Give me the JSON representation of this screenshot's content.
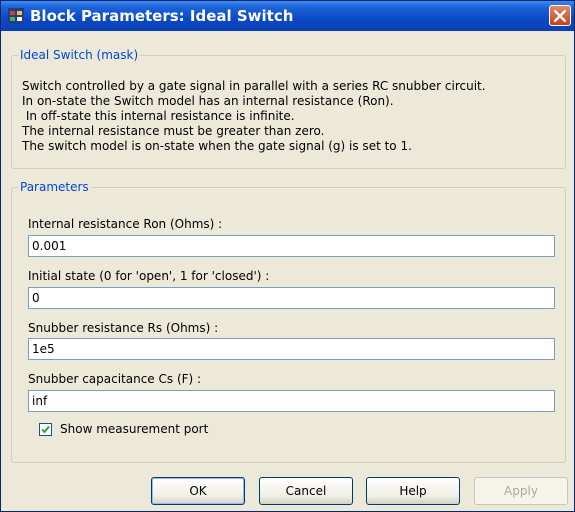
{
  "window": {
    "title": "Block Parameters: Ideal Switch"
  },
  "mask_group": {
    "legend": "Ideal Switch (mask)",
    "description": [
      "Switch controlled by a gate signal in parallel with a series RC snubber circuit.",
      "In on-state the Switch model has an internal resistance (Ron).",
      " In off-state this internal resistance is infinite.",
      "The internal resistance must be greater than zero.",
      "The switch model is on-state when the gate signal (g) is set to 1."
    ]
  },
  "params_group": {
    "legend": "Parameters",
    "fields": [
      {
        "label": "Internal resistance Ron (Ohms) :",
        "value": "0.001"
      },
      {
        "label": "Initial state (0 for 'open', 1 for 'closed') :",
        "value": "0"
      },
      {
        "label": "Snubber resistance Rs (Ohms) :",
        "value": "1e5"
      },
      {
        "label": "Snubber capacitance Cs (F) :",
        "value": "inf"
      }
    ],
    "checkbox": {
      "label": "Show measurement port",
      "checked": true
    }
  },
  "buttons": {
    "ok": "OK",
    "cancel": "Cancel",
    "help": "Help",
    "apply": "Apply"
  }
}
